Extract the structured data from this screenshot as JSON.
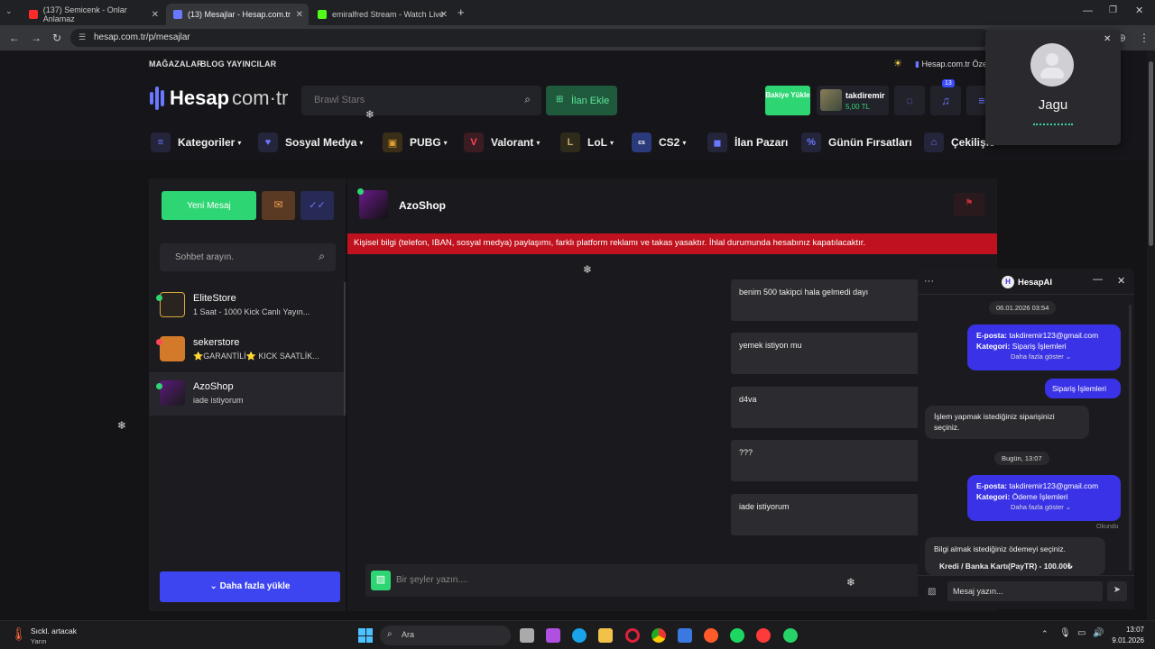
{
  "browser": {
    "tabs": [
      {
        "title": "(137) Semicenk - Onlar Anlamaz",
        "color": "#ff2a2a",
        "active": false
      },
      {
        "title": "(13) Mesajlar - Hesap.com.tr",
        "color": "#6a78ff",
        "active": true
      },
      {
        "title": "emiralfred Stream - Watch Live",
        "color": "#53fc18",
        "active": false
      }
    ],
    "url": "hesap.com.tr/p/mesajlar"
  },
  "header": {
    "toplinks": [
      "MAĞAZALAR",
      "BLOG",
      "YAYINCILAR"
    ],
    "right_link": "Hesap.com.tr Öze",
    "logo": "Hesap",
    "logo_suffix": "com·tr",
    "search_placeholder": "Brawl Stars",
    "add_listing": "İlan Ekle",
    "balance_button": "Bakiye Yükle",
    "user": {
      "name": "takdiremir",
      "balance": "5,00 TL"
    },
    "notification_count": "13"
  },
  "categories": [
    {
      "label": "Kategoriler",
      "dropdown": true,
      "icon": "menu-icon"
    },
    {
      "label": "Sosyal Medya",
      "dropdown": true,
      "icon": "heart-icon"
    },
    {
      "label": "PUBG",
      "dropdown": true,
      "icon": "pubg-icon"
    },
    {
      "label": "Valorant",
      "dropdown": true,
      "icon": "valorant-icon"
    },
    {
      "label": "LoL",
      "dropdown": true,
      "icon": "lol-icon"
    },
    {
      "label": "CS2",
      "dropdown": true,
      "icon": "cs2-icon"
    },
    {
      "label": "İlan Pazarı",
      "dropdown": false,
      "icon": "bag-icon"
    },
    {
      "label": "Günün Fırsatları",
      "dropdown": false,
      "icon": "percent-icon"
    },
    {
      "label": "Çekilişle",
      "dropdown": false,
      "icon": "gift-icon"
    }
  ],
  "sidebar": {
    "new_message": "Yeni Mesaj",
    "search_placeholder": "Sohbet arayın.",
    "conversations": [
      {
        "name": "EliteStore",
        "preview": "1 Saat - 1000 Kick Canlı Yayın...",
        "status": "#2ed573"
      },
      {
        "name": "sekerstore",
        "preview": "⭐GARANTİLİ⭐ KICK SAATLİK...",
        "status": "#ff4757"
      },
      {
        "name": "AzoShop",
        "preview": "iade istiyorum",
        "status": "#2ed573"
      }
    ],
    "load_more": "Daha fazla yükle"
  },
  "chat": {
    "title": "AzoShop",
    "warning": "Kişisel bilgi (telefon, IBAN, sosyal medya) paylaşımı, farklı platform reklamı ve takas yasaktır. İhlal durumunda hesabınız kapatılacaktır.",
    "messages": [
      "benim 500 takipci hala gelmedi dayı",
      "yemek istiyon mu",
      "d4va",
      "???",
      "iade istiyorum"
    ],
    "input_placeholder": "Bir şeyler yazın...."
  },
  "ai": {
    "title": "HesapAI",
    "date1": "06.01.2026 03:54",
    "msg1": {
      "label1": "E-posta:",
      "value1": "takdiremir123@gmail.com",
      "label2": "Kategori:",
      "value2": "Sipariş İşlemleri",
      "more": "Daha fazla göster"
    },
    "msg2": "Sipariş İşlemleri",
    "msg3": "İşlem yapmak istediğiniz siparişinizi seçiniz.",
    "date2": "Bugün, 13:07",
    "msg4": {
      "label1": "E-posta:",
      "value1": "takdiremir123@gmail.com",
      "label2": "Kategori:",
      "value2": "Ödeme İşlemleri",
      "more": "Daha fazla göster"
    },
    "read": "Okundu",
    "msg5": "Bilgi almak istediğiniz ödemeyi seçiniz.",
    "msg5_option": "Kredi / Banka Kartı(PayTR) - 100.00₺",
    "input_placeholder": "Mesaj yazın..."
  },
  "call": {
    "name": "Jagu"
  },
  "taskbar": {
    "weather_title": "Sıckl. artacak",
    "weather_sub": "Yarın",
    "search": "Ara",
    "time": "13:07",
    "date": "9.01.2026"
  }
}
